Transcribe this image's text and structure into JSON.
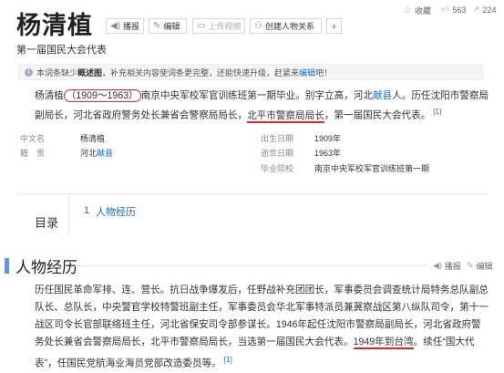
{
  "header": {
    "title": "杨清植",
    "subtitle": "第一届国民大会代表",
    "buttons": [
      {
        "label": "播报",
        "icon": "audio-icon"
      },
      {
        "label": "编辑",
        "icon": "pencil-icon"
      },
      {
        "label": "上传视频",
        "icon": "video-icon"
      },
      {
        "label": "创建人物关系",
        "icon": "people-icon"
      },
      {
        "label": "",
        "icon": "plus-icon"
      }
    ],
    "collect_label": "收藏",
    "like_count": "563",
    "share_count": "224"
  },
  "notice": {
    "text_before": "本词条缺少",
    "bold": "概述图",
    "text_after": "，补充相关内容使词条更完整，还能快速升级，赶紧来",
    "link": "编辑",
    "text_end": "吧！"
  },
  "intro": {
    "name": "杨清植",
    "years": "（1909～1963）",
    "t1": "南京中央军校军官训练班第一期毕业。别字立高，河北",
    "link1": "献县",
    "t2": "人。历任沈阳市警察局副局长，河北省政府警务处长兼省会警察局局长，",
    "marked": "北平市警察局局长",
    "t3": "，第一届国民大会代表。",
    "ref": "[1]"
  },
  "basic_info": {
    "left": [
      {
        "label": "中文名",
        "value": "杨清植"
      },
      {
        "label": "籍　贯",
        "value_prefix": "河北",
        "value_link": "献县"
      }
    ],
    "right": [
      {
        "label": "出生日期",
        "value": "1909年"
      },
      {
        "label": "逝世日期",
        "value": "1963年"
      },
      {
        "label": "毕业院校",
        "value": "南京中央军校军官训练班第一期"
      }
    ]
  },
  "toc": {
    "title": "目录",
    "items": [
      {
        "num": "1",
        "label": "人物经历"
      }
    ]
  },
  "section": {
    "title": "人物经历",
    "actions": [
      {
        "label": "播报"
      },
      {
        "label": "编辑"
      }
    ],
    "p1": "历任国民革命军排、连、营长。抗日战争爆发后，任野战补充团团长，军事委员会调查统计局特务总队副总队长、总队长，中央警官学校特警班副主任，军事委员会华北军事特派员兼冀察战区第八纵队司令，第十一战区司令长官部联络班主任，河北省保安司令部参谋长。1946年起任沈阳市警察局副局长，河北省政府警务处长兼省会警察局局长，北平市警察局局长，当选第一届国民大会代表。",
    "marked2": "1949年到台湾",
    "p2": "。续任“国大代表”，任国民党航海业海员党部改造委员等。",
    "ref": "[1]"
  }
}
